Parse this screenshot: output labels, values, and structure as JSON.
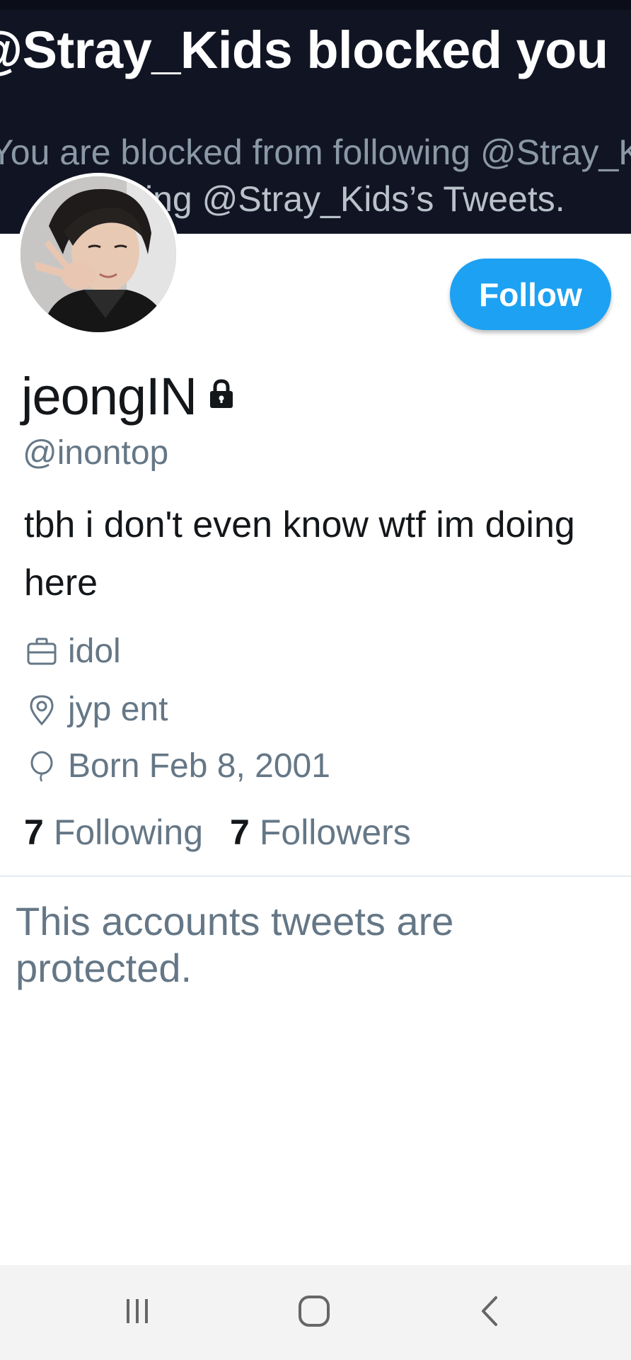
{
  "banner": {
    "title": "@Stray_Kids blocked you",
    "message_line1": "You are blocked from following @Stray_Kids",
    "message_line2": "ing @Stray_Kids’s Tweets."
  },
  "profile": {
    "display_name": "jeongIN",
    "handle": "@inontop",
    "bio": "tbh i don't even know wtf im doing here",
    "occupation": "idol",
    "location": "jyp ent",
    "birthday": "Born Feb 8, 2001",
    "following_count": "7",
    "following_label": "Following",
    "followers_count": "7",
    "followers_label": "Followers",
    "protected_locked": true
  },
  "actions": {
    "follow_label": "Follow"
  },
  "timeline": {
    "protected_message": "This accounts tweets are protected."
  },
  "icons": {
    "lock": "lock-icon",
    "occupation": "briefcase-icon",
    "location": "location-pin-icon",
    "birthday": "balloon-icon",
    "nav_recents": "recent-apps-icon",
    "nav_home": "home-icon",
    "nav_back": "back-icon"
  },
  "colors": {
    "banner_bg": "#111523",
    "accent": "#1da1f2",
    "secondary_text": "#657786",
    "primary_text": "#14171a",
    "nav_bar_bg": "#f3f3f3"
  }
}
